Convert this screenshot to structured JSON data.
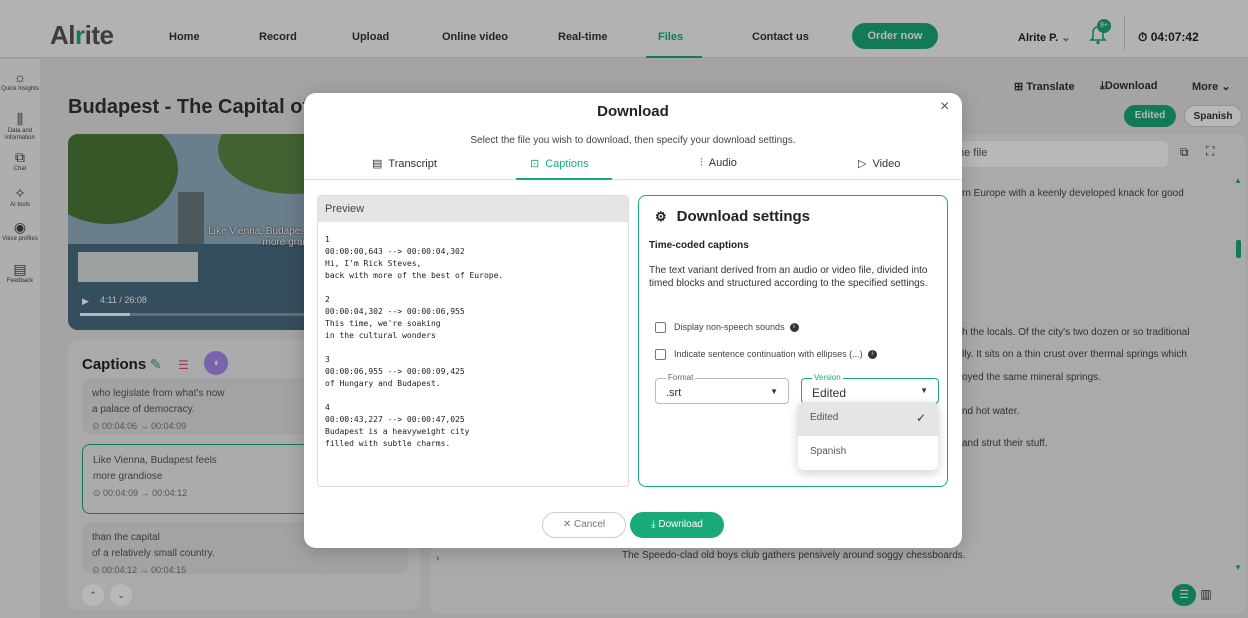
{
  "app": {
    "logo": "Alrite",
    "nav": [
      "Home",
      "Record",
      "Upload",
      "Online video",
      "Real-time",
      "Files",
      "Contact us"
    ],
    "order_label": "Order now",
    "user": "Alrite P.",
    "user_caret": "⌄",
    "badge": "9+",
    "timer": "04:07:42",
    "accent": "#1aaa7a"
  },
  "sidebar": {
    "items": [
      {
        "icon": "☼",
        "label": "Quick Insights"
      },
      {
        "icon": "⫼",
        "label": "Data and information"
      },
      {
        "icon": "⧉",
        "label": "Chat"
      },
      {
        "icon": "✧",
        "label": "AI tools"
      },
      {
        "icon": "◉",
        "label": "Voice profiles"
      },
      {
        "icon": "▤",
        "label": "Feedback"
      }
    ]
  },
  "video": {
    "title": "Budapest - The Capital of Hungary",
    "subtitle_l1": "Like Vienna, Budapest feels",
    "subtitle_l2": "more grandiose",
    "play": "▶",
    "time": "4:11 / 26:08",
    "progress": 0.21
  },
  "captions": {
    "heading": "Captions",
    "cards": [
      {
        "l1": "who legislate from what's now",
        "l2": "a palace of democracy.",
        "time": "⊙ 00:04:06 → 00:04:09"
      },
      {
        "l1": "Like Vienna, Budapest feels",
        "l2": "more grandiose",
        "time": "⊙ 00:04:09 → 00:04:12"
      },
      {
        "l1": "than the capital",
        "l2": "of a relatively small country.",
        "time": "⊙ 00:04:12 → 00:04:15"
      }
    ],
    "up": "⌃",
    "down": "⌄"
  },
  "right": {
    "translate": "Translate",
    "download": "Download",
    "more": "More ⌄",
    "pill_edited": "Edited",
    "pill_spanish": "Spanish",
    "search_placeholder": "he file",
    "lines": [
      "rn Europe with a keenly developed knack for good",
      "h the locals. Of the city's two dozen or so traditional",
      "lly. It sits on a thin crust over thermal springs which",
      "oyed the same mineral springs.",
      "nd hot water.",
      "and strut their stuff."
    ],
    "bottom_line": "The Speedo-clad old boys club gathers pensively around soggy chessboards."
  },
  "modal": {
    "title": "Download",
    "subtitle": "Select the file you wish to download, then specify your download settings.",
    "close": "×",
    "tabs": [
      {
        "icon": "▤",
        "label": "Transcript"
      },
      {
        "icon": "⊡",
        "label": "Captions"
      },
      {
        "icon": "⫶",
        "label": "Audio"
      },
      {
        "icon": "▷",
        "label": "Video"
      }
    ],
    "preview_label": "Preview",
    "preview_text": "1\n00:00:00,643 --> 00:00:04,302\nHi, I'm Rick Steves,\nback with more of the best of Europe.\n\n2\n00:00:04,302 --> 00:00:06,955\nThis time, we're soaking\nin the cultural wonders\n\n3\n00:00:06,955 --> 00:00:09,425\nof Hungary and Budapest.\n\n4\n00:00:43,227 --> 00:00:47,025\nBudapest is a heavyweight city\nfilled with subtle charms.",
    "settings_title": "Download settings",
    "settings_sub": "Time-coded captions",
    "settings_desc": "The text variant derived from an audio or video file, divided into timed blocks and structured according to the specified settings.",
    "chk1": "Display non-speech sounds",
    "chk2": "Indicate sentence continuation with ellipses (...)",
    "format_label": "Format",
    "format_value": ".srt",
    "version_label": "Version",
    "version_value": "Edited",
    "options": [
      "Edited",
      "Spanish"
    ],
    "cancel": "✕ Cancel",
    "download": "⤓ Download"
  }
}
